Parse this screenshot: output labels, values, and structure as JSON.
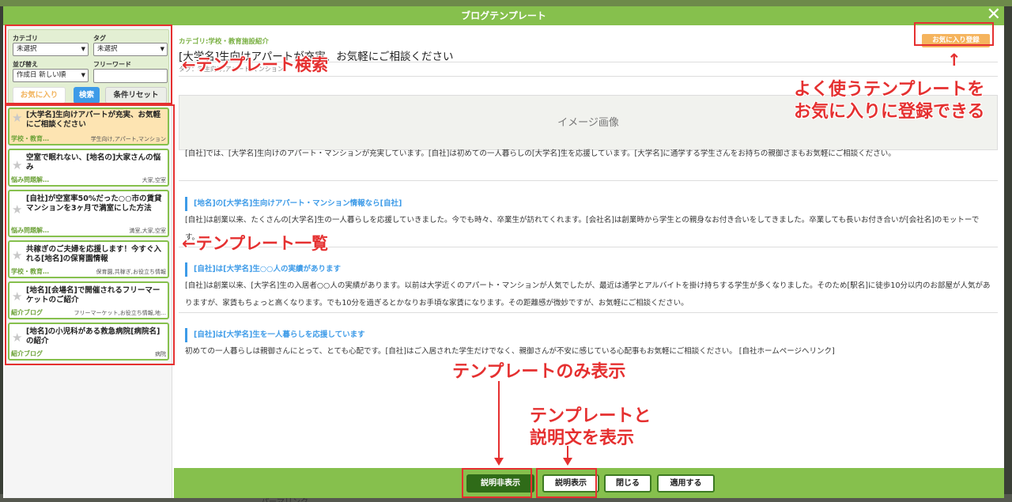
{
  "modal": {
    "title": "ブログテンプレート",
    "close_glyph": "✕"
  },
  "search": {
    "category_label": "カテゴリ",
    "category_value": "未選択",
    "tag_label": "タグ",
    "tag_value": "未選択",
    "sort_label": "並び替え",
    "sort_value": "作成日 新しい順",
    "keyword_label": "フリーワード",
    "keyword_value": "",
    "fav_button": "お気に入り",
    "search_button": "検索",
    "reset_button": "条件リセット"
  },
  "templates": [
    {
      "title": "[大学名]生向けアパートが充実、お気軽にご相談ください",
      "category": "学校・教育…",
      "tags": "学生向け,アパート,マンション",
      "active": true
    },
    {
      "title": "空室で眠れない、[地名の]大家さんの悩み",
      "category": "悩み問題解…",
      "tags": "大家,空室",
      "active": false
    },
    {
      "title": "[自社]が空室率50%だった○○市の賃貸マンションを3ヶ月で満室にした方法",
      "category": "悩み問題解…",
      "tags": "満室,大家,空室",
      "active": false
    },
    {
      "title": "共稼ぎのご夫婦を応援します！今すぐ入れる[地名]の保育園情報",
      "category": "学校・教育…",
      "tags": "保育園,共稼ぎ,お役立ち情報",
      "active": false
    },
    {
      "title": "[地名][会場名]で開催されるフリーマーケットのご紹介",
      "category": "紹介ブログ",
      "tags": "フリーマーケット,お役立ち情報,地…",
      "active": false
    },
    {
      "title": "[地名]の小児科がある救急病院[病院名]の紹介",
      "category": "紹介ブログ",
      "tags": "病院",
      "active": false
    }
  ],
  "preview": {
    "breadcrumb": "カテゴリ:学校・教育施設紹介",
    "title": "[大学名]生向けアパートが充実、お気軽にご相談ください",
    "tagline": "タグ：学生向け,アパート,マンション",
    "fav_register_button": "お気に入り登録",
    "image_placeholder": "イメージ画像",
    "intro": "[自社]では、[大学名]生向けのアパート・マンションが充実しています。[自社]は初めての一人暮らしの[大学名]生を応援しています。[大学名]に通学する学生さんをお持ちの親御さまもお気軽にご相談ください。",
    "sections": [
      {
        "heading": "[地名]の[大学名]生向けアパート・マンション情報なら[自社]",
        "body": "[自社]は創業以来、たくさんの[大学名]生の一人暮らしを応援していきました。今でも時々、卒業生が訪れてくれます。[会社名]は創業時から学生との親身なお付き合いをしてきました。卒業しても長いお付き合いが[会社名]のモットーです。"
      },
      {
        "heading": "[自社]は[大学名]生○○人の実績があります",
        "body": "[自社]は創業以来、[大学名]生の入居者○○人の実績があります。以前は大学近くのアパート・マンションが人気でしたが、最近は通学とアルバイトを掛け持ちする学生が多くなりました。そのため[駅名]に徒歩10分以内のお部屋が人気がありますが、家賃もちょっと高くなります。でも10分を過ぎるとかなりお手頃な家賃になります。その距離感が微妙ですが、お気軽にご相談ください。"
      },
      {
        "heading": "[自社]は[大学名]生を一人暮らしを応援しています",
        "body": "初めての一人暮らしは親御さんにとって、とても心配です。[自社]はご入居された学生だけでなく、親御さんが不安に感じている心配事もお気軽にご相談ください。 [自社ホームページへリンク]"
      }
    ]
  },
  "footer": {
    "hide_desc_button": "説明非表示",
    "show_desc_button": "説明表示",
    "close_button": "閉じる",
    "apply_button": "適用する"
  },
  "annotations": {
    "search_label": "←テンプレート検索",
    "list_label": "←テンプレート一覧",
    "fav_line1": "よく使うテンプレートを",
    "fav_line2": "お気に入りに登録できる",
    "fav_arrow": "↑",
    "template_only": "テンプレートのみ表示",
    "with_desc_line1": "テンプレートと",
    "with_desc_line2": "説明文を表示"
  },
  "background": {
    "bottom_text": "パーマリンク"
  },
  "colors": {
    "header_green": "#86c04d",
    "accent_blue": "#3d9be8",
    "favorite_orange": "#f5b45d",
    "annotation_red": "#e53030",
    "dark_green": "#2f6b18"
  }
}
